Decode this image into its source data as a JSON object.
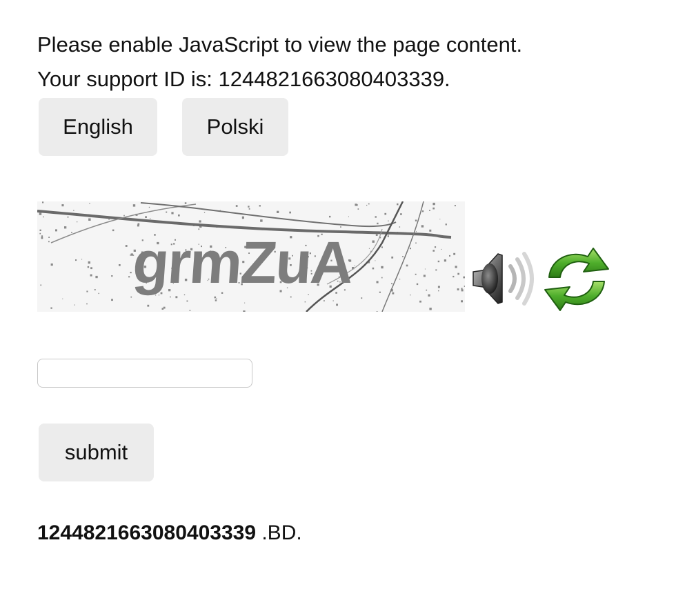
{
  "messages": {
    "enable_js": "Please enable JavaScript to view the page content.",
    "support_id_line": "Your support ID is: 1244821663080403339."
  },
  "language_buttons": {
    "english": "English",
    "polski": "Polski"
  },
  "captcha": {
    "text": "grmZuA",
    "audio_icon": "speaker-icon",
    "refresh_icon": "refresh-icon"
  },
  "answer_input": {
    "value": "",
    "placeholder": ""
  },
  "submit_label": "submit",
  "footer": {
    "support_id": "1244821663080403339",
    "suffix": " .BD."
  }
}
